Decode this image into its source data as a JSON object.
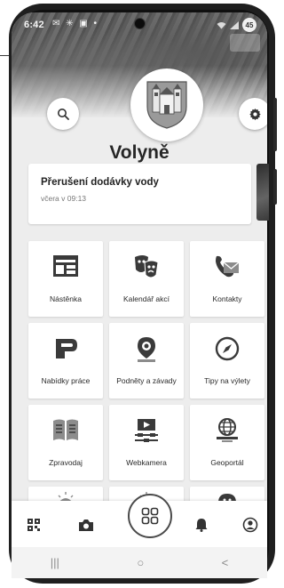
{
  "status_bar": {
    "time": "6:42",
    "left_icons": [
      "chat-bubble-icon",
      "asterisk-icon",
      "mail-icon",
      "dot-icon"
    ],
    "right_icons": [
      "signal-icon",
      "wifi-icon"
    ],
    "battery_level": "45"
  },
  "header": {
    "town_name": "Volyně",
    "search_icon": "search-icon",
    "settings_icon": "gear-icon"
  },
  "news": {
    "title": "Přerušení dodávky vody",
    "date": "včera v 09:13"
  },
  "carousel": {
    "count": 2,
    "active_index": 0
  },
  "tiles": [
    {
      "label": "Nástěnka",
      "icon": "noticeboard-icon"
    },
    {
      "label": "Kalendář akcí",
      "icon": "theater-masks-icon"
    },
    {
      "label": "Kontakty",
      "icon": "phone-mail-icon"
    },
    {
      "label": "Nabídky práce",
      "icon": "job-offer-icon"
    },
    {
      "label": "Podněty a závady",
      "icon": "report-pin-icon"
    },
    {
      "label": "Tipy na výlety",
      "icon": "compass-icon"
    },
    {
      "label": "Zpravodaj",
      "icon": "book-icon"
    },
    {
      "label": "Webkamera",
      "icon": "webcam-icon"
    },
    {
      "label": "Geoportál",
      "icon": "globe-monitor-icon"
    }
  ],
  "bottom_nav": [
    "qr-code-icon",
    "camera-icon",
    "grid-icon",
    "bell-icon",
    "user-icon"
  ],
  "system_nav": {
    "recents": "|||",
    "home": "○",
    "back": "<"
  },
  "colors": {
    "background": "#ededed",
    "card": "#ffffff",
    "text": "#262626"
  }
}
